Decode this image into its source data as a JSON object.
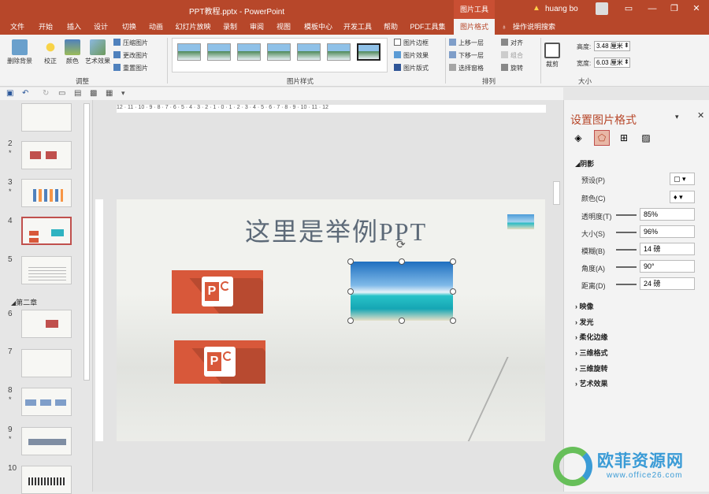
{
  "title": {
    "document": "PPT教程.pptx  -  PowerPoint",
    "context_tab": "图片工具",
    "user": "huang bo"
  },
  "tabs": [
    "文件",
    "开始",
    "插入",
    "设计",
    "切换",
    "动画",
    "幻灯片放映",
    "录制",
    "审阅",
    "视图",
    "模板中心",
    "开发工具",
    "帮助",
    "PDF工具集",
    "图片格式",
    "操作说明搜索"
  ],
  "ribbon": {
    "adjust": {
      "remove_bg": "删除背景",
      "correct": "校正",
      "color": "颜色",
      "art_effects": "艺术效果",
      "compress": "压缩图片",
      "change": "更改图片",
      "reset": "重置图片",
      "label": "调整"
    },
    "styles": {
      "border": "图片边框",
      "effects": "图片效果",
      "layout": "图片版式",
      "label": "图片样式"
    },
    "arrange": {
      "bring_forward": "上移一层",
      "send_backward": "下移一层",
      "selection_pane": "选择窗格",
      "align": "对齐",
      "group": "组合",
      "rotate": "旋转",
      "label": "排列"
    },
    "size": {
      "crop": "裁剪",
      "height_label": "高度:",
      "height": "3.48 厘米",
      "width_label": "宽度:",
      "width": "6.03 厘米",
      "label": "大小"
    }
  },
  "slides": {
    "numbers": [
      "2",
      "3",
      "4",
      "5",
      "6",
      "7",
      "8",
      "9",
      "10"
    ],
    "section": "第二章"
  },
  "slide": {
    "title": "这里是举例PPT"
  },
  "panel": {
    "title": "设置图片格式",
    "shadow_section": "阴影",
    "preset_label": "预设(P)",
    "color_label": "颜色(C)",
    "transparency_label": "透明度(T)",
    "transparency": "85%",
    "size_label": "大小(S)",
    "size": "96%",
    "blur_label": "模糊(B)",
    "blur": "14 磅",
    "angle_label": "角度(A)",
    "angle": "90°",
    "distance_label": "距离(D)",
    "distance": "24 磅",
    "sections": [
      "映像",
      "发光",
      "柔化边缘",
      "三维格式",
      "三维旋转",
      "艺术效果"
    ]
  },
  "watermark": {
    "text": "欧菲资源网",
    "url": "www.office26.com"
  },
  "ruler_labels": "12 · 11 · 10 · 9 · 8 · 7 · 6 · 5 · 4 · 3 · 2 · 1 · 0 · 1 · 2 · 3 · 4 · 5 · 6 · 7 · 8 · 9 · 10 · 11 · 12"
}
